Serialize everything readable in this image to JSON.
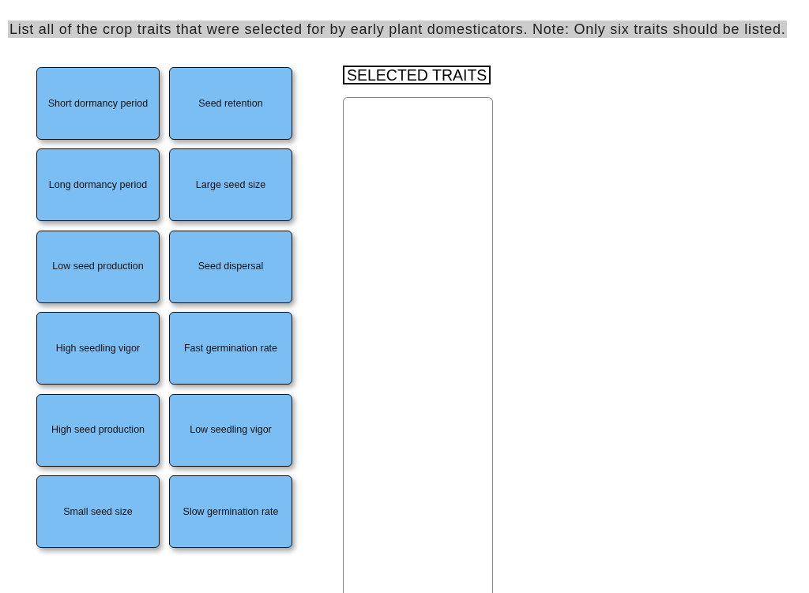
{
  "prompt": "List all of the crop traits that were selected for by early plant domesticators. Note: Only six traits should be listed.",
  "trait_cards": [
    "Short dormancy period",
    "Seed retention",
    "Long dormancy period",
    "Large seed size",
    "Low seed production",
    "Seed dispersal",
    "High seedling vigor",
    "Fast germination rate",
    "High seed production",
    "Low seedling vigor",
    "Small seed size",
    "Slow germination rate"
  ],
  "drop_zone": {
    "title": "SELECTED TRAITS"
  }
}
